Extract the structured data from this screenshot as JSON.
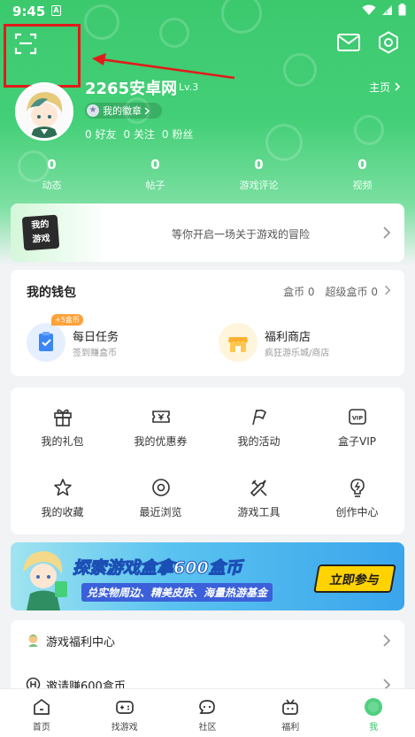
{
  "status_bar": {
    "time": "9:45",
    "indicator": "A"
  },
  "profile": {
    "username": "2265安卓网",
    "level": "Lv.3",
    "badge_label": "我的徽章",
    "homepage_label": "主页",
    "social": [
      "0 好友",
      "0 关注",
      "0 粉丝"
    ]
  },
  "stats": [
    {
      "value": "0",
      "label": "动态"
    },
    {
      "value": "0",
      "label": "帖子"
    },
    {
      "value": "0",
      "label": "游戏评论"
    },
    {
      "value": "0",
      "label": "视频"
    }
  ],
  "my_games": {
    "logo_line1": "我的",
    "logo_line2": "游戏",
    "text": "等你开启一场关于游戏的冒险"
  },
  "wallet": {
    "title": "我的钱包",
    "coins": "盒币 0",
    "super_coins": "超级盒币 0",
    "daily_task": {
      "tag": "+5盒币",
      "title": "每日任务",
      "subtitle": "签到赚盒币"
    },
    "welfare_shop": {
      "title": "福利商店",
      "subtitle": "疯狂游乐城/商店"
    }
  },
  "grid": [
    {
      "label": "我的礼包",
      "icon": "gift-icon"
    },
    {
      "label": "我的优惠券",
      "icon": "coupon-icon"
    },
    {
      "label": "我的活动",
      "icon": "flag-icon"
    },
    {
      "label": "盒子VIP",
      "icon": "vip-icon"
    },
    {
      "label": "我的收藏",
      "icon": "star-icon"
    },
    {
      "label": "最近浏览",
      "icon": "eye-icon"
    },
    {
      "label": "游戏工具",
      "icon": "tools-icon"
    },
    {
      "label": "创作中心",
      "icon": "bulb-icon"
    }
  ],
  "banner": {
    "title": "探索游戏盒拿600盒币",
    "subtitle": "兑实物周边、精美皮肤、海量热游基金",
    "button": "立即参与"
  },
  "list": [
    {
      "label": "游戏福利中心",
      "icon": "welfare-center-icon"
    },
    {
      "label": "邀请赚600盒币",
      "icon": "invite-icon"
    }
  ],
  "bottom_nav": [
    {
      "label": "首页",
      "icon": "home-icon"
    },
    {
      "label": "找游戏",
      "icon": "gamepad-icon"
    },
    {
      "label": "社区",
      "icon": "community-icon"
    },
    {
      "label": "福利",
      "icon": "welfare-icon"
    },
    {
      "label": "我",
      "icon": "me-icon",
      "active": true
    }
  ],
  "colors": {
    "brand_green": "#3cc96e",
    "annotation_red": "#e21a1a",
    "accent_yellow": "#ffd300"
  }
}
